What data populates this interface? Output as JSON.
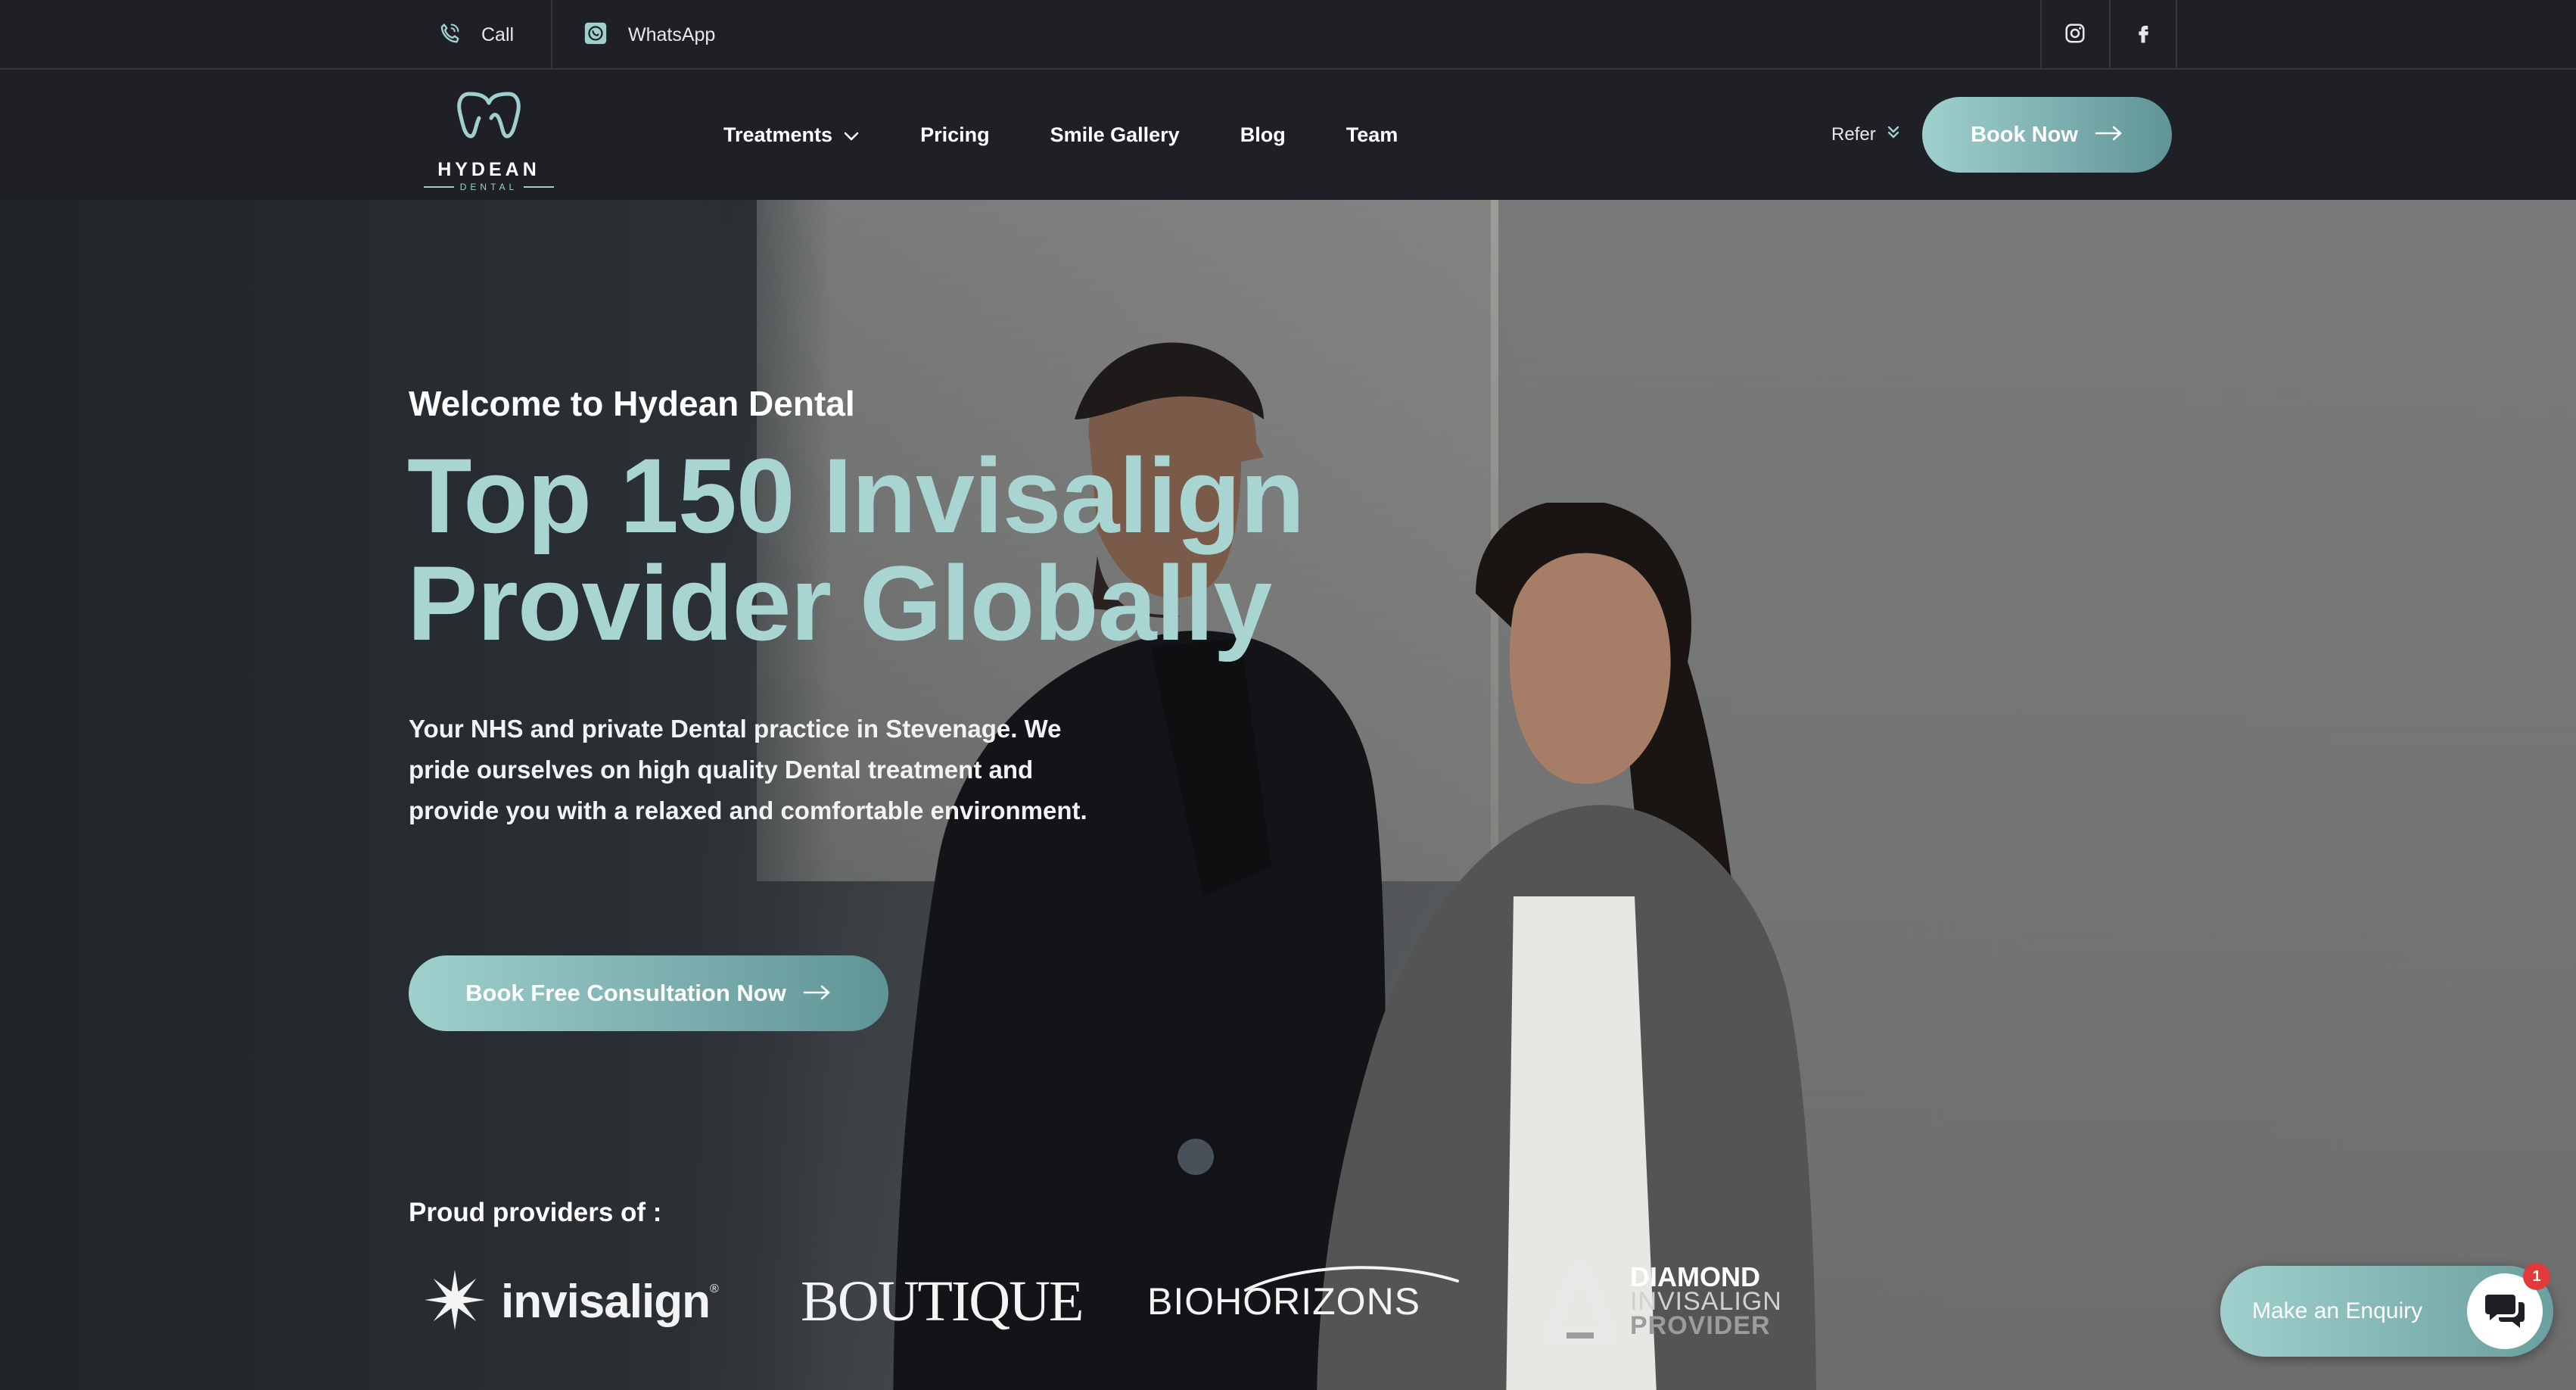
{
  "topbar": {
    "call_label": "Call",
    "whatsapp_label": "WhatsApp",
    "social": [
      "instagram-icon",
      "facebook-icon"
    ]
  },
  "brand": {
    "name": "HYDEAN",
    "sub": "DENTAL"
  },
  "nav": {
    "items": [
      {
        "label": "Treatments",
        "has_dropdown": true
      },
      {
        "label": "Pricing"
      },
      {
        "label": "Smile Gallery"
      },
      {
        "label": "Blog"
      },
      {
        "label": "Team"
      }
    ],
    "refer_label": "Refer",
    "book_label": "Book Now"
  },
  "hero": {
    "kicker": "Welcome to Hydean Dental",
    "title_line1": "Top 150 Invisalign",
    "title_line2": "Provider Globally",
    "description": "Your NHS and private Dental practice in Stevenage. We pride ourselves on high quality Dental treatment and provide you with a relaxed and comfortable environment.",
    "cta_label": "Book Free Consultation Now"
  },
  "providers": {
    "title": "Proud providers of :",
    "invisalign": "invisalign",
    "boutique": "BOUTIQUE",
    "biohorizons": "BIOHORIZONS",
    "diamond_line1": "DIAMOND",
    "diamond_line2": "INVISALIGN",
    "diamond_line3": "PROVIDER"
  },
  "enquiry": {
    "label": "Make an Enquiry",
    "badge_count": "1"
  },
  "colors": {
    "accent": "#a8d4d1",
    "button_gradient_start": "#9fd0cd",
    "button_gradient_end": "#5f9496",
    "bar_bg": "#1e2026",
    "badge": "#e03a3a"
  }
}
